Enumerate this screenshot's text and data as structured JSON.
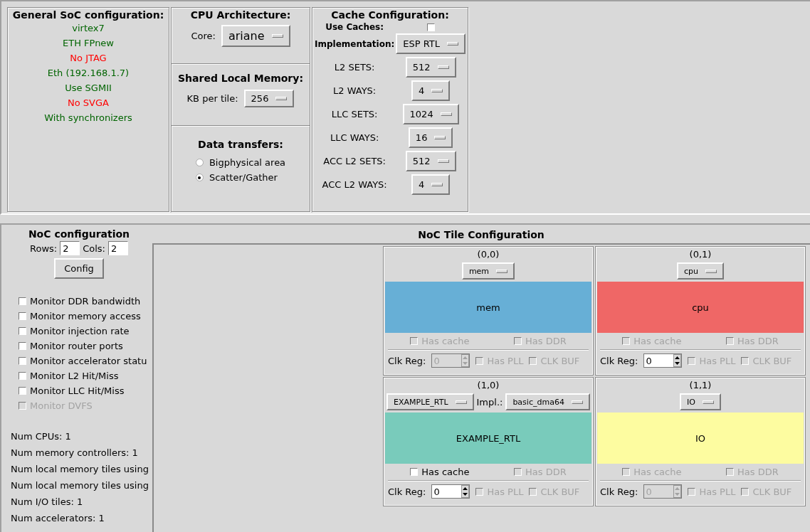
{
  "general": {
    "title": "General SoC configuration:",
    "items": [
      {
        "text": "virtex7",
        "color": "#006400"
      },
      {
        "text": "ETH FPnew",
        "color": "#006400"
      },
      {
        "text": "No JTAG",
        "color": "#ff0000"
      },
      {
        "text": "Eth (192.168.1.7)",
        "color": "#006400"
      },
      {
        "text": "Use SGMII",
        "color": "#006400"
      },
      {
        "text": "No SVGA",
        "color": "#ff0000"
      },
      {
        "text": "With synchronizers",
        "color": "#006400"
      }
    ]
  },
  "cpu": {
    "title": "CPU Architecture:",
    "core_label": "Core:",
    "core_value": "ariane"
  },
  "shared_memory": {
    "title": "Shared Local Memory:",
    "label": "KB per tile:",
    "value": "256"
  },
  "data_transfers": {
    "title": "Data transfers:",
    "options": [
      {
        "label": "Bigphysical area",
        "selected": false
      },
      {
        "label": "Scatter/Gather",
        "selected": true
      }
    ]
  },
  "cache": {
    "title": "Cache Configuration:",
    "use_caches": {
      "label": "Use Caches:",
      "checked": false
    },
    "implementation": {
      "label": "Implementation:",
      "value": "ESP RTL"
    },
    "settings": [
      {
        "label": "L2 SETS:",
        "value": "512"
      },
      {
        "label": "L2 WAYS:",
        "value": "4"
      },
      {
        "label": "LLC SETS:",
        "value": "1024"
      },
      {
        "label": "LLC WAYS:",
        "value": "16"
      },
      {
        "label": "ACC L2 SETS:",
        "value": "512"
      },
      {
        "label": "ACC L2 WAYS:",
        "value": "4"
      }
    ]
  },
  "noc": {
    "title": "NoC configuration",
    "rows_label": "Rows:",
    "rows_value": "2",
    "cols_label": "Cols:",
    "cols_value": "2",
    "config_button": "Config",
    "monitors": [
      {
        "label": "Monitor DDR bandwidth",
        "checked": false,
        "disabled": false
      },
      {
        "label": "Monitor memory access",
        "checked": false,
        "disabled": false
      },
      {
        "label": "Monitor injection rate",
        "checked": false,
        "disabled": false
      },
      {
        "label": "Monitor router ports",
        "checked": false,
        "disabled": false
      },
      {
        "label": "Monitor accelerator statu",
        "checked": false,
        "disabled": false
      },
      {
        "label": "Monitor L2 Hit/Miss",
        "checked": false,
        "disabled": false
      },
      {
        "label": "Monitor LLC Hit/Miss",
        "checked": false,
        "disabled": false
      },
      {
        "label": "Monitor DVFS",
        "checked": false,
        "disabled": true
      }
    ],
    "stats": [
      "Num CPUs: 1",
      "Num memory controllers: 1",
      "Num local memory tiles using",
      "Num local memory tiles using",
      "Num I/O tiles: 1",
      "Num accelerators: 1"
    ]
  },
  "tile_config": {
    "title": "NoC Tile Configuration",
    "tiles": [
      {
        "coord": "(0,0)",
        "type": "mem",
        "label": "mem",
        "color": "#67afd6",
        "clk_label": "Clk Reg:",
        "clk_value": "0",
        "clk_disabled": true,
        "options": [
          {
            "label": "Has cache",
            "checked": false,
            "disabled": true
          },
          {
            "label": "Has DDR",
            "checked": false,
            "disabled": true
          }
        ],
        "clock_options": [
          {
            "label": "Has PLL",
            "checked": false,
            "disabled": true
          },
          {
            "label": "CLK BUF",
            "checked": false,
            "disabled": true
          }
        ]
      },
      {
        "coord": "(0,1)",
        "type": "cpu",
        "label": "cpu",
        "color": "#ef6766",
        "clk_label": "Clk Reg:",
        "clk_value": "0",
        "clk_disabled": false,
        "options": [
          {
            "label": "Has cache",
            "checked": false,
            "disabled": true
          },
          {
            "label": "Has DDR",
            "checked": false,
            "disabled": true
          }
        ],
        "clock_options": [
          {
            "label": "Has PLL",
            "checked": false,
            "disabled": true
          },
          {
            "label": "CLK BUF",
            "checked": false,
            "disabled": true
          }
        ]
      },
      {
        "coord": "(1,0)",
        "type": "EXAMPLE_RTL",
        "impl_label": "Impl.:",
        "impl_value": "basic_dma64",
        "label": "EXAMPLE_RTL",
        "color": "#79cbbb",
        "clk_label": "Clk Reg:",
        "clk_value": "0",
        "clk_disabled": false,
        "options": [
          {
            "label": "Has cache",
            "checked": false,
            "disabled": false
          },
          {
            "label": "Has DDR",
            "checked": false,
            "disabled": true
          }
        ],
        "clock_options": [
          {
            "label": "Has PLL",
            "checked": false,
            "disabled": true
          },
          {
            "label": "CLK BUF",
            "checked": false,
            "disabled": true
          }
        ]
      },
      {
        "coord": "(1,1)",
        "type": "IO",
        "label": "IO",
        "color": "#fdfca0",
        "clk_label": "Clk Reg:",
        "clk_value": "0",
        "clk_disabled": true,
        "options": [
          {
            "label": "Has cache",
            "checked": false,
            "disabled": true
          },
          {
            "label": "Has DDR",
            "checked": false,
            "disabled": true
          }
        ],
        "clock_options": [
          {
            "label": "Has PLL",
            "checked": false,
            "disabled": true
          },
          {
            "label": "CLK BUF",
            "checked": false,
            "disabled": true
          }
        ]
      }
    ]
  }
}
